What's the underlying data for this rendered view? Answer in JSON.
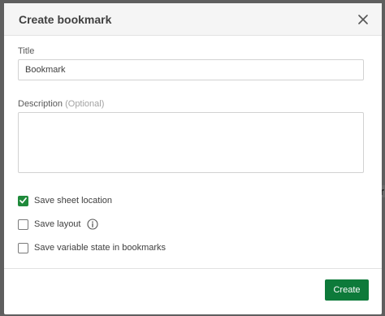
{
  "dialog": {
    "title": "Create bookmark",
    "close_icon": "close-icon"
  },
  "form": {
    "title_label": "Title",
    "title_value": "Bookmark",
    "description_label": "Description",
    "description_optional": "(Optional)",
    "description_value": ""
  },
  "options": {
    "save_sheet_location": {
      "label": "Save sheet location",
      "checked": true
    },
    "save_layout": {
      "label": "Save layout",
      "checked": false,
      "icon": "info-icon"
    },
    "save_variable_state": {
      "label": "Save variable state in bookmarks",
      "checked": false
    }
  },
  "footer": {
    "create_label": "Create"
  },
  "colors": {
    "accent": "#0d7a3a",
    "checkbox_checked": "#1f8a3b"
  },
  "background": {
    "partial_char": "r"
  }
}
